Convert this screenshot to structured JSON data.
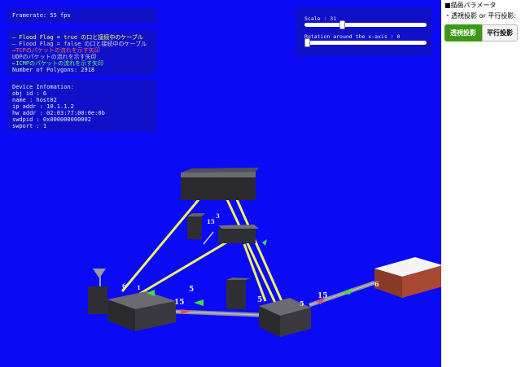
{
  "viewport": {
    "background": "#0a0af5",
    "framerate": "Framerate: 55 fps",
    "legend": [
      {
        "text": "— Flood Flag = true  の口と接続中のケーブル",
        "color": "#ffff66"
      },
      {
        "text": "— Flood Flag = false の口と接続中のケーブル",
        "color": "#cfcfe8"
      },
      {
        "text": "→TCPのパケットの流れを示す矢印",
        "color": "#ff6666"
      },
      {
        "text": "  UDPのパケットの流れを示す矢印",
        "color": "#cfcfe8"
      },
      {
        "text": "←ICMPのパケットの流れを示す矢印",
        "color": "#66ff66"
      },
      {
        "text": "Number of Polygons: 2918",
        "color": "#e8e8ff"
      }
    ],
    "device_info": [
      "Device Infomation:",
      "obj id :  6",
      "name :  host02",
      "ip addr :  10.1.1.2",
      "hw addr :  02:03:77:00:0e:0b",
      "swdpid :  0x000000000002",
      "swport :  1"
    ],
    "controls": {
      "scale_label": "Scale    : 31",
      "scale_value": 31,
      "rotation_label": "Rotation around the x-axis    : 0",
      "rotation_value": 0
    },
    "port_labels": [
      "5",
      "15",
      "5",
      "15",
      "15",
      "5",
      "6",
      "6",
      "3",
      "1"
    ],
    "colors": {
      "cable_true": "#f0f060",
      "cable_false": "#c8c8d8",
      "tcp": "#e05060",
      "icmp": "#40e040"
    }
  },
  "side_panel": {
    "title": "■描画パラメータ",
    "projection_label": "・透視投影 or 平行投影:",
    "perspective_button": "透視投影",
    "orthographic_button": "平行投影",
    "accent": "#3a9a16"
  }
}
